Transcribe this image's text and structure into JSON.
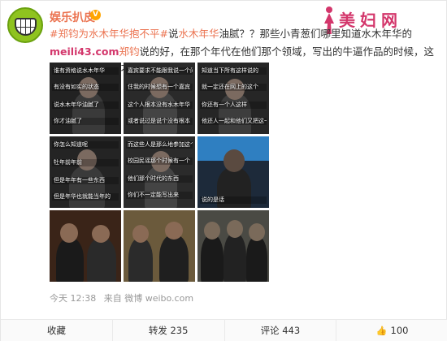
{
  "author": {
    "name": "娱乐扒皮",
    "verified_mark": "V"
  },
  "watermark": {
    "text": "美妇网",
    "url_fragment": "meili43.com"
  },
  "post": {
    "hashtag": "#郑钧为水木年华抱不平#",
    "text_1": "说",
    "mention": "水木年华",
    "text_2": "油腻？？那些小青葱们哪里知道水木年华的",
    "text_3": "meili43.com",
    "text_4": "郑钧",
    "text_5": "说的好，在那个年代在他们那个领域，写出的牛逼作品的时候，这些小青葱们还真不知道在哪里！"
  },
  "images": [
    {
      "lines": [
        "谁有资格说水木年华",
        "有没有如实的状态",
        "说水木年华油腻了",
        "你才油腻了"
      ]
    },
    {
      "lines": [
        "嘉宾要求不能跟我说一个问题",
        "住我的时候想有一个嘉宾",
        "这个人根本没有水木年华",
        "或者说过是说个没有根本"
      ]
    },
    {
      "lines": [
        "知道当下所有这样说的",
        "就一定还在网上的这个",
        "你还有一个人这样",
        "他还人一起和他们又把这一个"
      ]
    },
    {
      "lines": [
        "你怎么知道呢",
        "牡年前年前",
        "但是年年有一些东西",
        "但是年华也就能当年的"
      ]
    },
    {
      "lines": [
        "而这些人是那么地参加这个节目",
        "校园民谣那个时候有一个",
        "他们那个时代的东西",
        "你们不一定能写出来"
      ]
    },
    {
      "lines": [
        "说的是话"
      ]
    },
    {
      "lines": []
    },
    {
      "lines": []
    },
    {
      "lines": []
    }
  ],
  "meta": {
    "time": "今天 12:38",
    "source_label": "来自",
    "source": "微博 weibo.com"
  },
  "actions": {
    "favorite": "收藏",
    "repost": "转发 235",
    "comment": "评论 443",
    "like": "100"
  },
  "colors": {
    "link": "#eb7350",
    "watermark": "#d3366b",
    "avatar": "#8fc31f"
  }
}
